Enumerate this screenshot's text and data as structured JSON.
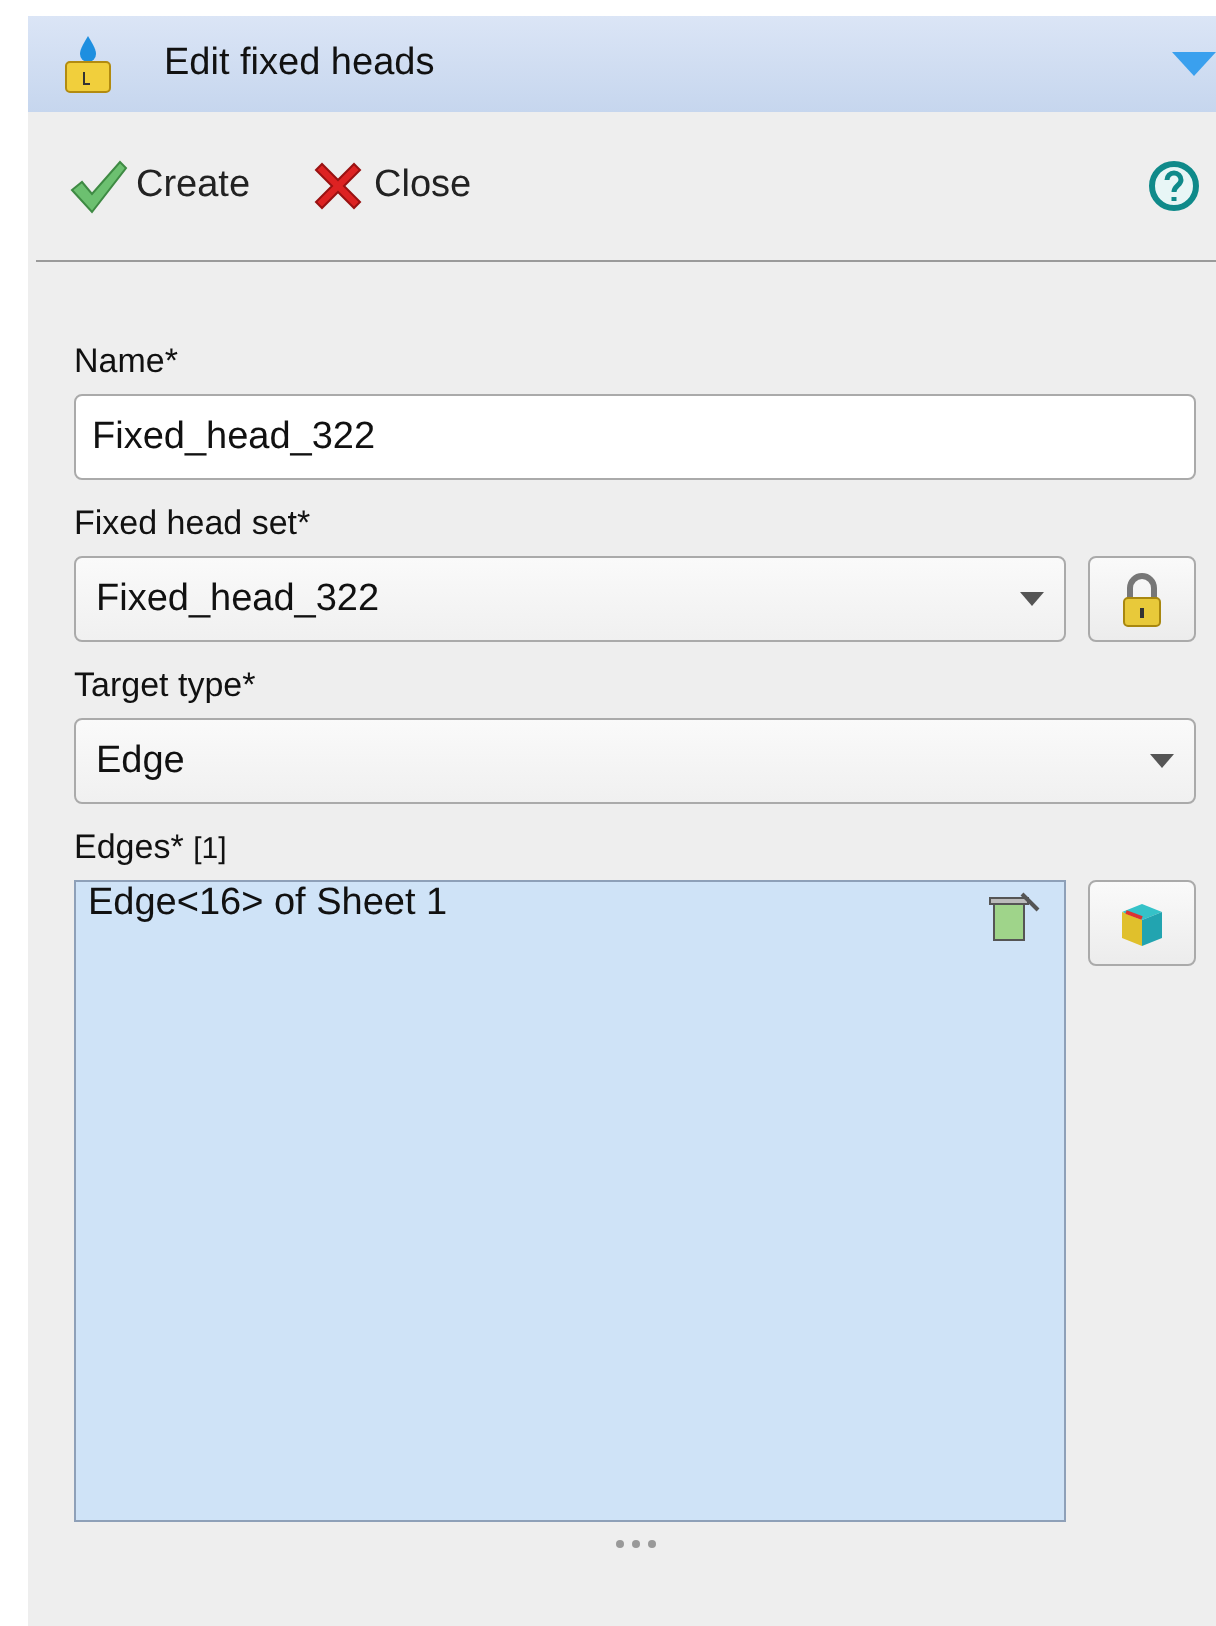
{
  "header": {
    "title": "Edit fixed heads"
  },
  "toolbar": {
    "buttons": [
      {
        "kind": "create",
        "label": "Create"
      },
      {
        "kind": "close",
        "label": "Close"
      }
    ]
  },
  "form": {
    "name": {
      "label": "Name*",
      "value": "Fixed_head_322"
    },
    "fixed_head_set": {
      "label": "Fixed head set*",
      "value": "Fixed_head_322"
    },
    "target_type": {
      "label": "Target type*",
      "value": "Edge"
    },
    "edges": {
      "label": "Edges*",
      "count": "[1]",
      "items": [
        "Edge<16> of Sheet 1"
      ]
    }
  }
}
